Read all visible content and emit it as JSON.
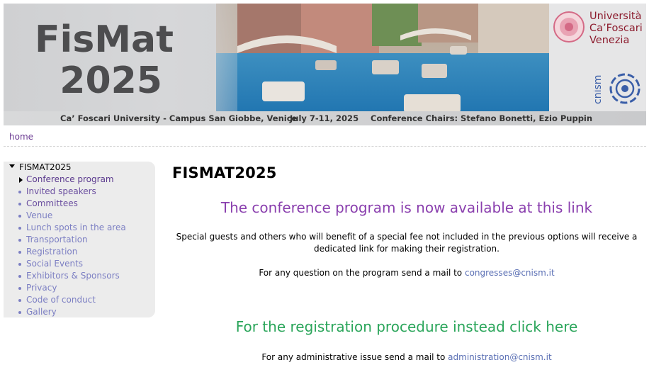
{
  "banner": {
    "title_line1": "FisMat",
    "title_line2": "2025",
    "strip_venue": "Ca’ Foscari University - Campus San Giobbe, Venice",
    "strip_dates": "July 7-11, 2025",
    "strip_chairs": "Conference Chairs: Stefano Bonetti, Ezio Puppin",
    "university_line1": "Università",
    "university_line2": "Ca’Foscari",
    "university_line3": "Venezia",
    "cnism_text": "cnism",
    "colors": {
      "university": "#8c1b2d",
      "cnism": "#3a5ea8",
      "water": "#2f8fc9"
    }
  },
  "breadcrumb": {
    "home": "home"
  },
  "sidebar": {
    "root": "FISMAT2025",
    "items": [
      {
        "label": "Conference program",
        "marker": "arrow"
      },
      {
        "label": "Invited speakers",
        "marker": "bullet"
      },
      {
        "label": "Committees",
        "marker": "bullet"
      },
      {
        "label": "Venue",
        "marker": "bullet"
      },
      {
        "label": "Lunch spots in the area",
        "marker": "bullet"
      },
      {
        "label": "Transportation",
        "marker": "bullet"
      },
      {
        "label": "Registration",
        "marker": "bullet"
      },
      {
        "label": "Social Events",
        "marker": "bullet"
      },
      {
        "label": "Exhibitors & Sponsors",
        "marker": "bullet"
      },
      {
        "label": "Privacy",
        "marker": "bullet"
      },
      {
        "label": "Code of conduct",
        "marker": "bullet"
      },
      {
        "label": "Gallery",
        "marker": "bullet"
      }
    ]
  },
  "main": {
    "title": "FISMAT2025",
    "program_link": "The conference program is now available at this link",
    "special_fee_text": "Special guests and others who will benefit of a special fee not included in the previous options will receive a dedicated link for making their registration.",
    "program_question_text": "For any question on the program send a mail to ",
    "program_email": "congresses@cnism.it",
    "registration_link": "For the registration procedure instead click here",
    "admin_text": "For any administrative issue send a mail to ",
    "admin_email": "administration@cnism.it",
    "colors": {
      "program_link": "#8a3fae",
      "registration_link": "#2aa55a",
      "email_link": "#5a6fb4"
    }
  }
}
